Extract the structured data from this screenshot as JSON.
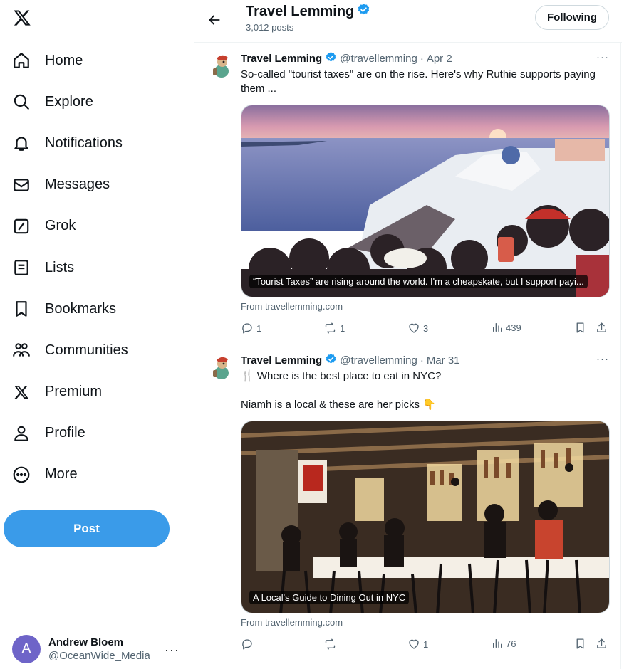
{
  "sidebar": {
    "logo_icon": "x-logo-icon",
    "items": [
      {
        "label": "Home",
        "icon": "home-icon"
      },
      {
        "label": "Explore",
        "icon": "search-icon"
      },
      {
        "label": "Notifications",
        "icon": "bell-icon"
      },
      {
        "label": "Messages",
        "icon": "envelope-icon"
      },
      {
        "label": "Grok",
        "icon": "grok-icon"
      },
      {
        "label": "Lists",
        "icon": "list-icon"
      },
      {
        "label": "Bookmarks",
        "icon": "bookmark-icon"
      },
      {
        "label": "Communities",
        "icon": "people-icon"
      },
      {
        "label": "Premium",
        "icon": "x-logo-icon"
      },
      {
        "label": "Profile",
        "icon": "person-icon"
      },
      {
        "label": "More",
        "icon": "more-circle-icon"
      }
    ],
    "post_label": "Post",
    "account": {
      "avatar_letter": "A",
      "name": "Andrew Bloem",
      "handle": "@OceanWide_Media",
      "more": "···"
    }
  },
  "header": {
    "title": "Travel Lemming",
    "post_count": "3,012 posts",
    "following_label": "Following"
  },
  "tweets": [
    {
      "name": "Travel Lemming",
      "handle": "@travellemming",
      "dot": "·",
      "date": "Apr 2",
      "menu": "···",
      "text": "So-called \"tourist taxes\" are on the rise. Here's why Ruthie supports paying them ...",
      "card_caption": "“Tourist Taxes” are rising around the world. I'm a cheapskate, but I support payi...",
      "card_from": "From travellemming.com",
      "replies": "1",
      "reposts": "1",
      "likes": "3",
      "views": "439"
    },
    {
      "name": "Travel Lemming",
      "handle": "@travellemming",
      "dot": "·",
      "date": "Mar 31",
      "menu": "···",
      "text_line1": "🍴 Where is the best place to eat in NYC?",
      "text_line2": "Niamh is a local & these are her picks 👇",
      "card_caption": "A Local's Guide to Dining Out in NYC",
      "card_from": "From travellemming.com",
      "replies": "",
      "reposts": "",
      "likes": "1",
      "views": "76"
    }
  ],
  "colors": {
    "accent": "#1d9bf0",
    "post_button": "#3a9be9",
    "muted": "#536471",
    "border": "#eff3f4"
  }
}
